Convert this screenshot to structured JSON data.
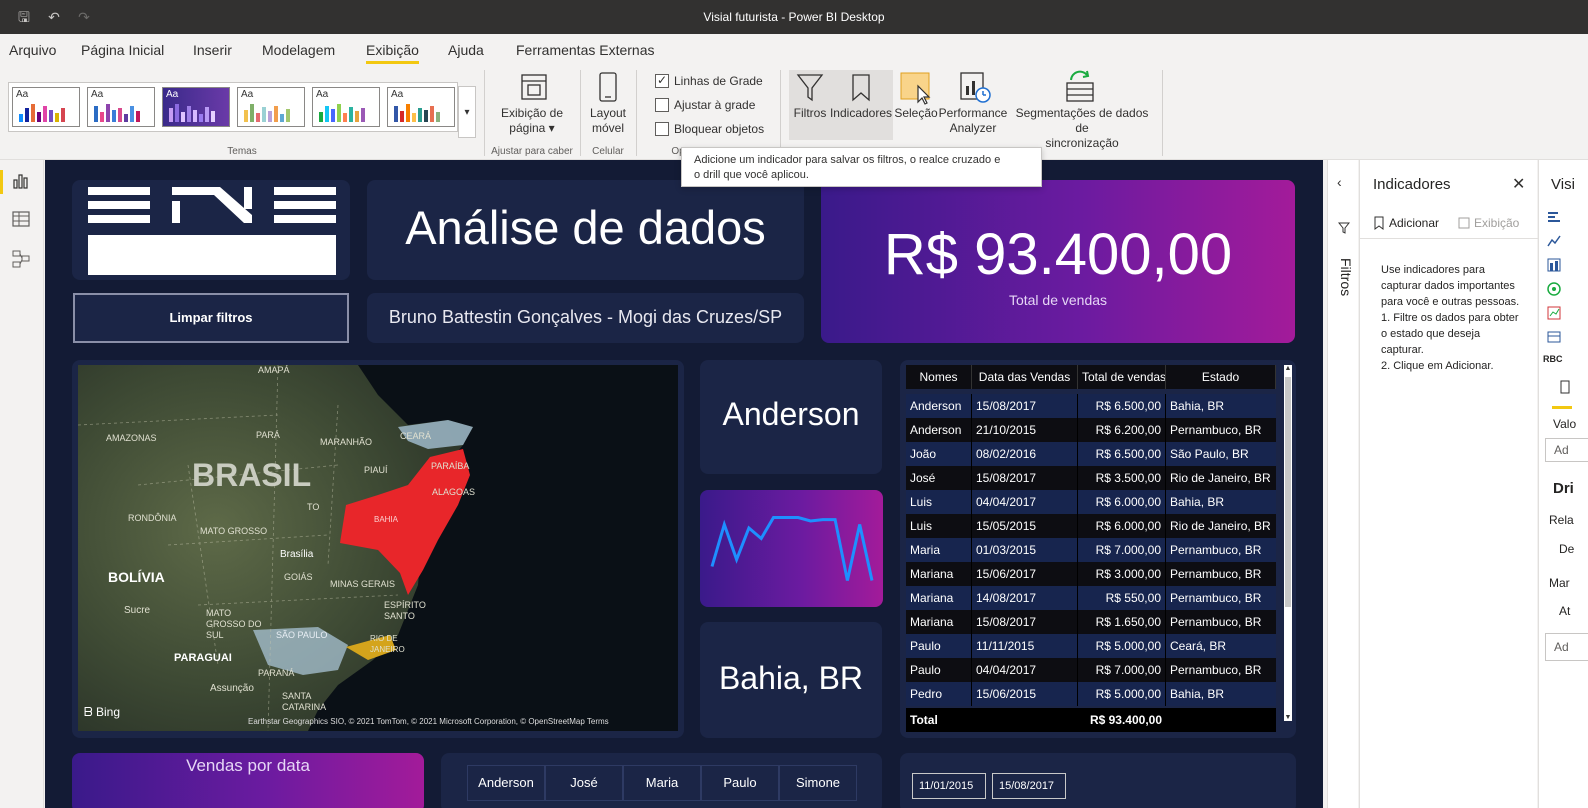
{
  "app": {
    "window_title": "Visial futurista - Power BI Desktop"
  },
  "menu": {
    "items": [
      "Arquivo",
      "Página Inicial",
      "Inserir",
      "Modelagem",
      "Exibição",
      "Ajuda",
      "Ferramentas Externas"
    ],
    "active": "Exibição"
  },
  "ribbon": {
    "themes_label": "Temas",
    "theme_aa": "Aa",
    "page_view": {
      "line1": "Exibição de",
      "line2": "página ▾"
    },
    "fit_label": "Ajustar para caber",
    "mobile_layout": {
      "line1": "Layout",
      "line2": "móvel"
    },
    "mobile_label": "Celular",
    "options_label": "Op",
    "checkboxes": [
      {
        "label": "Linhas de Grade",
        "checked": true
      },
      {
        "label": "Ajustar à grade",
        "checked": false
      },
      {
        "label": "Bloquear objetos",
        "checked": false
      }
    ],
    "filters": "Filtros",
    "bookmarks": "Indicadores",
    "selection": "Seleção",
    "performance": {
      "line1": "Performance",
      "line2": "Analyzer"
    },
    "sync": {
      "line1": "Segmentações de dados de",
      "line2": "sincronização"
    }
  },
  "tooltip": {
    "line1": "Adicione um indicador para salvar os filtros, o realce cruzado e",
    "line2": "o drill que você aplicou."
  },
  "report": {
    "clear_filters": "Limpar filtros",
    "title": "Análise de dados",
    "author": "Bruno Battestin Gonçalves - Mogi das Cruzes/SP",
    "kpi_value": "R$ 93.400,00",
    "kpi_label": "Total de vendas",
    "card_name": "Anderson",
    "card_state": "Bahia, BR",
    "sales_by_date": "Vendas por data",
    "name_slicer": [
      "Anderson",
      "José",
      "Maria",
      "Paulo",
      "Simone"
    ],
    "date_from": "11/01/2015",
    "date_to": "15/08/2017",
    "sparkline": [
      0.25,
      0.85,
      0.35,
      0.8,
      0.65,
      0.95,
      0.95,
      0.95,
      0.9,
      0.92,
      0.92,
      0.05,
      0.85,
      0.05
    ]
  },
  "map": {
    "labels": [
      {
        "text": "AMAPÁ"
      },
      {
        "text": "AMAZONAS"
      },
      {
        "text": "PARÁ"
      },
      {
        "text": "MARANHÃO"
      },
      {
        "text": "CEARÁ"
      },
      {
        "text": "BRASIL"
      },
      {
        "text": "PIAUÍ"
      },
      {
        "text": "PARAÍBA"
      },
      {
        "text": "ALAGOAS"
      },
      {
        "text": "TO"
      },
      {
        "text": "RONDÔNIA"
      },
      {
        "text": "BAHIA"
      },
      {
        "text": "MATO GROSSO"
      },
      {
        "text": "Brasília"
      },
      {
        "text": "GOIÁS"
      },
      {
        "text": "BOLÍVIA"
      },
      {
        "text": "MINAS GERAIS"
      },
      {
        "text": "Sucre"
      },
      {
        "text": "MATO GROSSO DO SUL"
      },
      {
        "text": "ESPÍRITO SANTO"
      },
      {
        "text": "SÃO PAULO"
      },
      {
        "text": "RIO DE JANEIRO"
      },
      {
        "text": "PARAGUAI"
      },
      {
        "text": "PARANÁ"
      },
      {
        "text": "Assunção"
      },
      {
        "text": "SANTA CATARINA"
      }
    ],
    "bing": "Bing",
    "attribution": "Earthstar Geographics SIO, © 2021 TomTom, © 2021 Microsoft Corporation, © OpenStreetMap",
    "terms": "Terms"
  },
  "table": {
    "headers": [
      "Nomes",
      "Data das Vendas",
      "Total de vendas",
      "Estado"
    ],
    "rows": [
      [
        "Anderson",
        "15/08/2017",
        "R$ 6.500,00",
        "Bahia, BR"
      ],
      [
        "Anderson",
        "21/10/2015",
        "R$ 6.200,00",
        "Pernambuco, BR"
      ],
      [
        "João",
        "08/02/2016",
        "R$ 6.500,00",
        "São Paulo, BR"
      ],
      [
        "José",
        "15/08/2017",
        "R$ 3.500,00",
        "Rio de Janeiro, BR"
      ],
      [
        "Luis",
        "04/04/2017",
        "R$ 6.000,00",
        "Bahia, BR"
      ],
      [
        "Luis",
        "15/05/2015",
        "R$ 6.000,00",
        "Rio de Janeiro, BR"
      ],
      [
        "Maria",
        "01/03/2015",
        "R$ 7.000,00",
        "Pernambuco, BR"
      ],
      [
        "Mariana",
        "15/06/2017",
        "R$ 3.000,00",
        "Pernambuco, BR"
      ],
      [
        "Mariana",
        "14/08/2017",
        "R$ 550,00",
        "Pernambuco, BR"
      ],
      [
        "Mariana",
        "15/08/2017",
        "R$ 1.650,00",
        "Pernambuco, BR"
      ],
      [
        "Paulo",
        "11/11/2015",
        "R$ 5.000,00",
        "Ceará, BR"
      ],
      [
        "Paulo",
        "04/04/2017",
        "R$ 7.000,00",
        "Pernambuco, BR"
      ],
      [
        "Pedro",
        "15/06/2015",
        "R$ 5.000,00",
        "Bahia, BR"
      ]
    ],
    "total_label": "Total",
    "total_value": "R$ 93.400,00"
  },
  "bookmarks_pane": {
    "title": "Indicadores",
    "add": "Adicionar",
    "view": "Exibição",
    "help": [
      "Use indicadores para capturar dados importantes para você e outras pessoas.",
      "1. Filtre os dados para obter o estado que deseja capturar.",
      "2. Clique em Adicionar."
    ],
    "filters_tab": "Filtros"
  },
  "vis_pane": {
    "title": "Visi",
    "values": "Valo",
    "add1": "Ad",
    "drill": "Dri",
    "rel": "Rela",
    "de": "De",
    "mar": "Mar",
    "at": "At",
    "add2": "Ad"
  },
  "colors": {
    "canvas": "#131b35",
    "card": "#1b2546",
    "accent_yellow": "#f2c811",
    "highlight_red": "#e8262a",
    "gradient_start": "#3a1a8a",
    "gradient_end": "#a31b9a"
  }
}
